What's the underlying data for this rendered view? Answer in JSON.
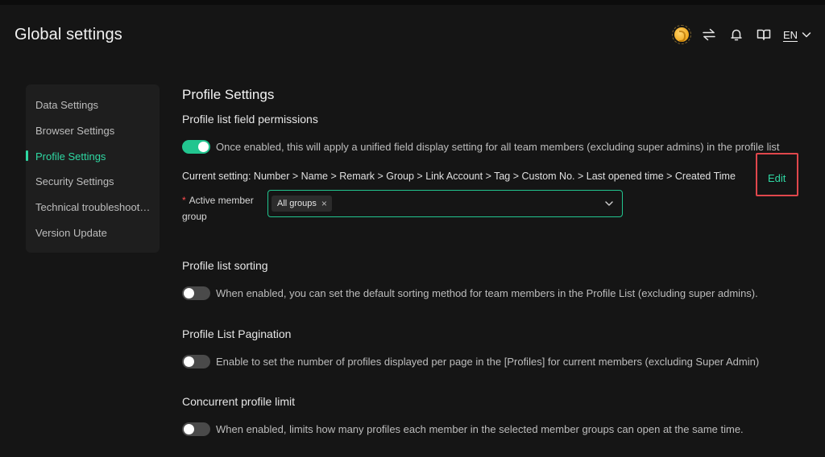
{
  "header": {
    "title": "Global settings",
    "language": "EN",
    "icons": [
      "coin-icon",
      "switch-arrows-icon",
      "bell-icon",
      "book-icon",
      "chevron-down-icon"
    ]
  },
  "sidebar": {
    "items": [
      {
        "label": "Data Settings",
        "active": false
      },
      {
        "label": "Browser Settings",
        "active": false
      },
      {
        "label": "Profile Settings",
        "active": true
      },
      {
        "label": "Security Settings",
        "active": false
      },
      {
        "label": "Technical troubleshooting",
        "active": false
      },
      {
        "label": "Version Update",
        "active": false
      }
    ]
  },
  "main": {
    "title": "Profile Settings",
    "field_permissions": {
      "title": "Profile list field permissions",
      "enabled": true,
      "description": "Once enabled, this will apply a unified field display setting for all team members (excluding super admins) in the profile list",
      "current_setting": "Current setting: Number > Name > Remark > Group > Link Account > Tag > Custom No. > Last opened time > Created Time",
      "edit_label": "Edit",
      "member_group_label": "Active member group",
      "member_group_value": "All groups"
    },
    "sorting": {
      "title": "Profile list sorting",
      "enabled": false,
      "description": "When enabled, you can set the default sorting method for team members in the Profile List (excluding super admins)."
    },
    "pagination": {
      "title": "Profile List Pagination",
      "enabled": false,
      "description": "Enable to set the number of profiles displayed per page in the [Profiles] for current members (excluding Super Admin)"
    },
    "concurrent": {
      "title": "Concurrent profile limit",
      "enabled": false,
      "description": "When enabled, limits how many profiles each member in the selected member groups can open at the same time."
    }
  },
  "colors": {
    "accent": "#22c58f",
    "highlight": "#e0474c",
    "background": "#151515"
  }
}
